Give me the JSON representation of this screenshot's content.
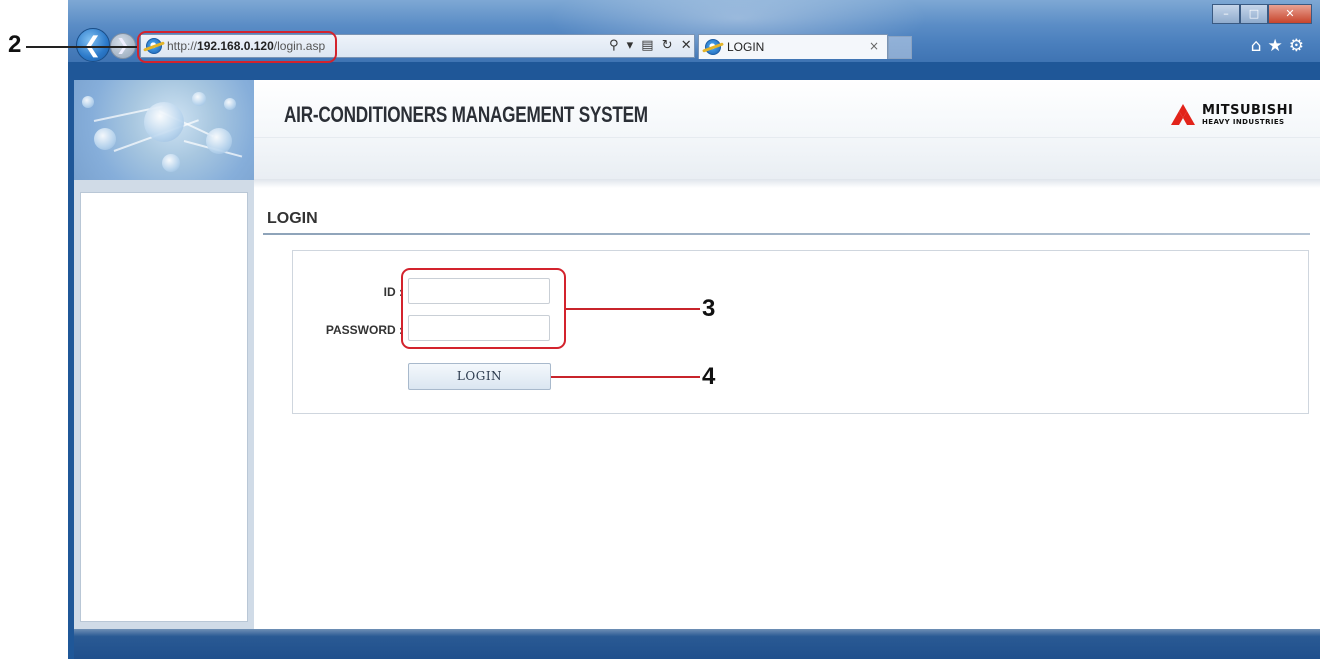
{
  "browser": {
    "url_prefix": "http://",
    "url_host": "192.168.0.120",
    "url_path": "/login.asp",
    "address_tools": "⚲ ▾ ▤ ↻ ✕",
    "tab_title": "LOGIN",
    "tab_close": "×",
    "window_controls": {
      "minimize": "–",
      "maximize": "□",
      "close": "✕"
    },
    "toolbar_icons": "⌂★⚙"
  },
  "header": {
    "title": "AIR-CONDITIONERS MANAGEMENT SYSTEM",
    "brand_main": "MITSUBISHI",
    "brand_sub": "HEAVY INDUSTRIES",
    "brand_color": "#e2231a"
  },
  "login": {
    "heading": "LOGIN",
    "id_label": "ID :",
    "id_value": "",
    "password_label": "PASSWORD :",
    "password_value": "",
    "button_label": "LOGIN"
  },
  "callouts": {
    "address": "2",
    "inputs": "3",
    "button": "4",
    "color": "#d3232d"
  },
  "icons": {
    "back": "back-arrow-icon",
    "forward": "forward-arrow-icon",
    "ie": "internet-explorer-icon",
    "home": "home-icon",
    "favorites": "star-icon",
    "tools": "gear-icon"
  }
}
